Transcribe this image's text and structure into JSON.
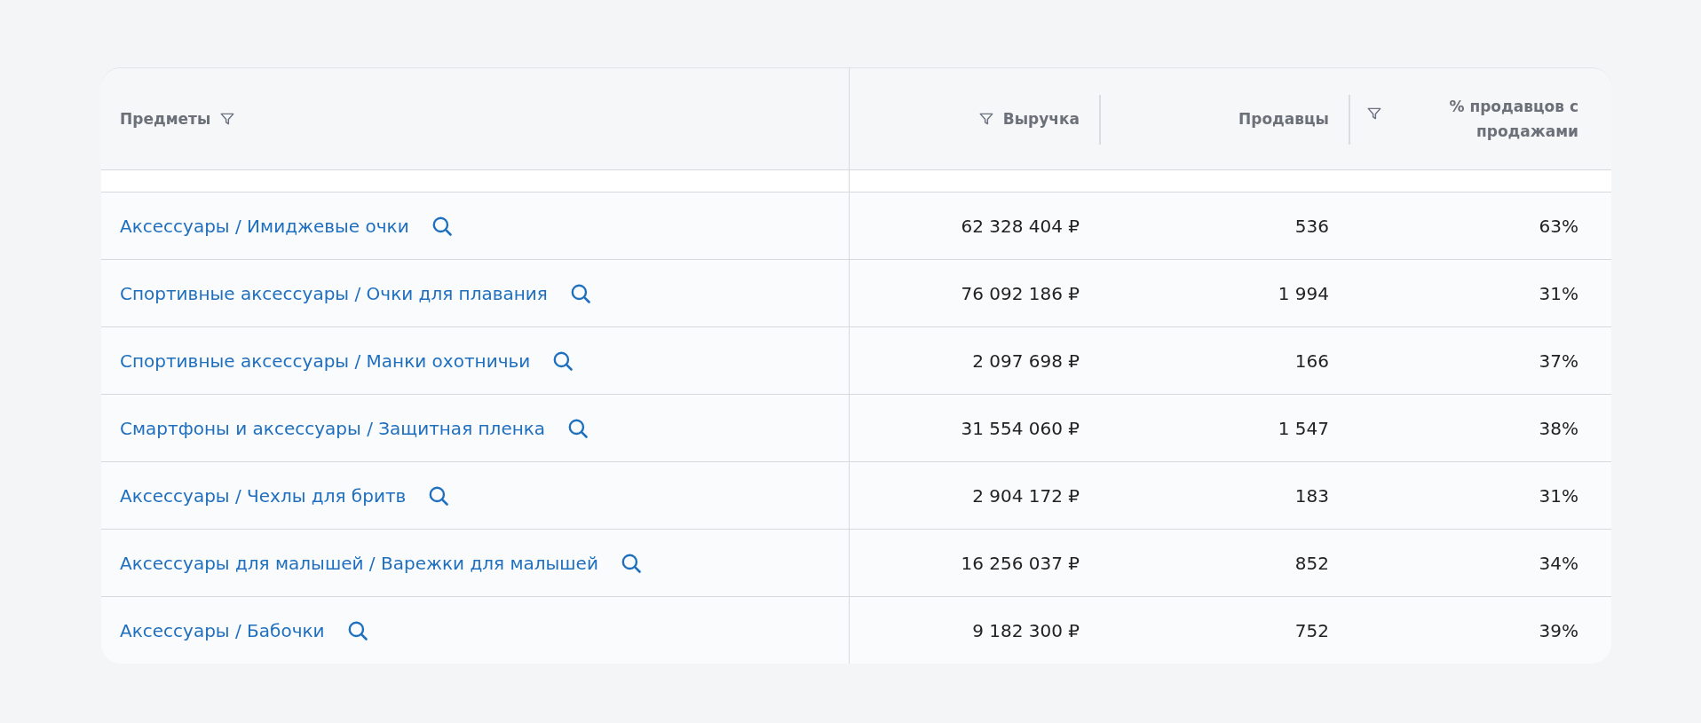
{
  "table": {
    "columns": [
      {
        "label": "Предметы",
        "kind": "trailing"
      },
      {
        "label": "Выручка",
        "kind": "leading"
      },
      {
        "label": "Продавцы",
        "kind": "plain"
      },
      {
        "label": "% продавцов с продажами",
        "kind": "corner"
      }
    ],
    "rows": [
      {
        "subject": "Аксессуары / Имиджевые очки",
        "revenue": "62 328 404 ₽",
        "sellers": "536",
        "percent": "63%"
      },
      {
        "subject": "Спортивные аксессуары / Очки для плавания",
        "revenue": "76 092 186 ₽",
        "sellers": "1 994",
        "percent": "31%"
      },
      {
        "subject": "Спортивные аксессуары / Манки охотничьи",
        "revenue": "2 097 698 ₽",
        "sellers": "166",
        "percent": "37%"
      },
      {
        "subject": "Смартфоны и аксессуары / Защитная пленка",
        "revenue": "31 554 060 ₽",
        "sellers": "1 547",
        "percent": "38%"
      },
      {
        "subject": "Аксессуары / Чехлы для бритв",
        "revenue": "2 904 172 ₽",
        "sellers": "183",
        "percent": "31%"
      },
      {
        "subject": "Аксессуары для малышей / Варежки для малышей",
        "revenue": "16 256 037 ₽",
        "sellers": "852",
        "percent": "34%"
      },
      {
        "subject": "Аксессуары / Бабочки",
        "revenue": "9 182 300 ₽",
        "sellers": "752",
        "percent": "39%"
      }
    ]
  }
}
